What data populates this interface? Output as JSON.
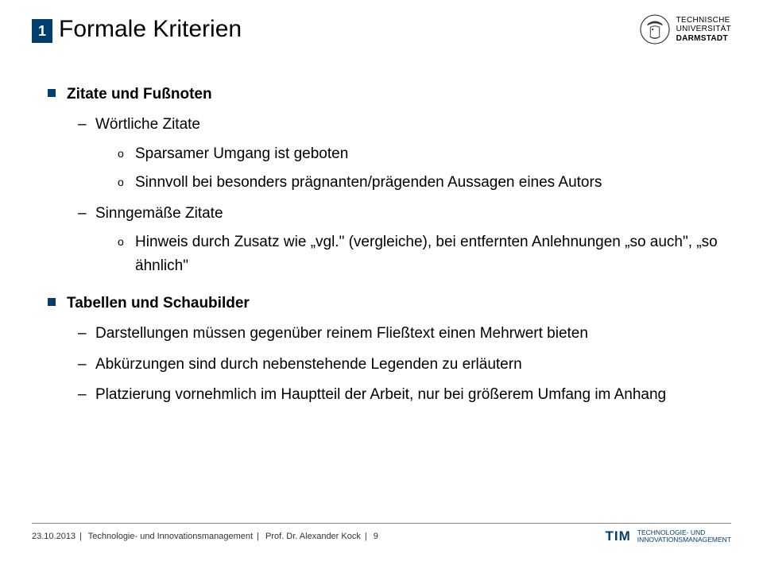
{
  "header": {
    "badge": "1",
    "title": "Formale Kriterien",
    "uni": {
      "l1": "TECHNISCHE",
      "l2": "UNIVERSITÄT",
      "l3": "DARMSTADT"
    }
  },
  "body": {
    "b1": {
      "label": "Zitate und Fußnoten",
      "d1": {
        "label": "Wörtliche Zitate",
        "c1": "Sparsamer Umgang ist geboten",
        "c2": "Sinnvoll bei besonders prägnanten/prägenden Aussagen eines Autors"
      },
      "d2": {
        "label": "Sinngemäße Zitate",
        "c1": "Hinweis durch Zusatz wie „vgl.\" (vergleiche), bei entfernten Anlehnungen „so auch\", „so ähnlich\""
      }
    },
    "b2": {
      "label": "Tabellen und Schaubilder",
      "d1": "Darstellungen müssen gegenüber reinem Fließtext einen Mehrwert bieten",
      "d2": "Abkürzungen sind durch nebenstehende Legenden zu erläutern",
      "d3": "Platzierung vornehmlich im Hauptteil der Arbeit, nur bei größerem Umfang im Anhang"
    }
  },
  "footer": {
    "date": "23.10.2013",
    "dept": "Technologie- und Innovationsmanagement",
    "author": "Prof. Dr. Alexander Kock",
    "page": "9",
    "tim": "TIM",
    "timline1": "TECHNOLOGIE- UND",
    "timline2": "INNOVATIONSMANAGEMENT"
  }
}
